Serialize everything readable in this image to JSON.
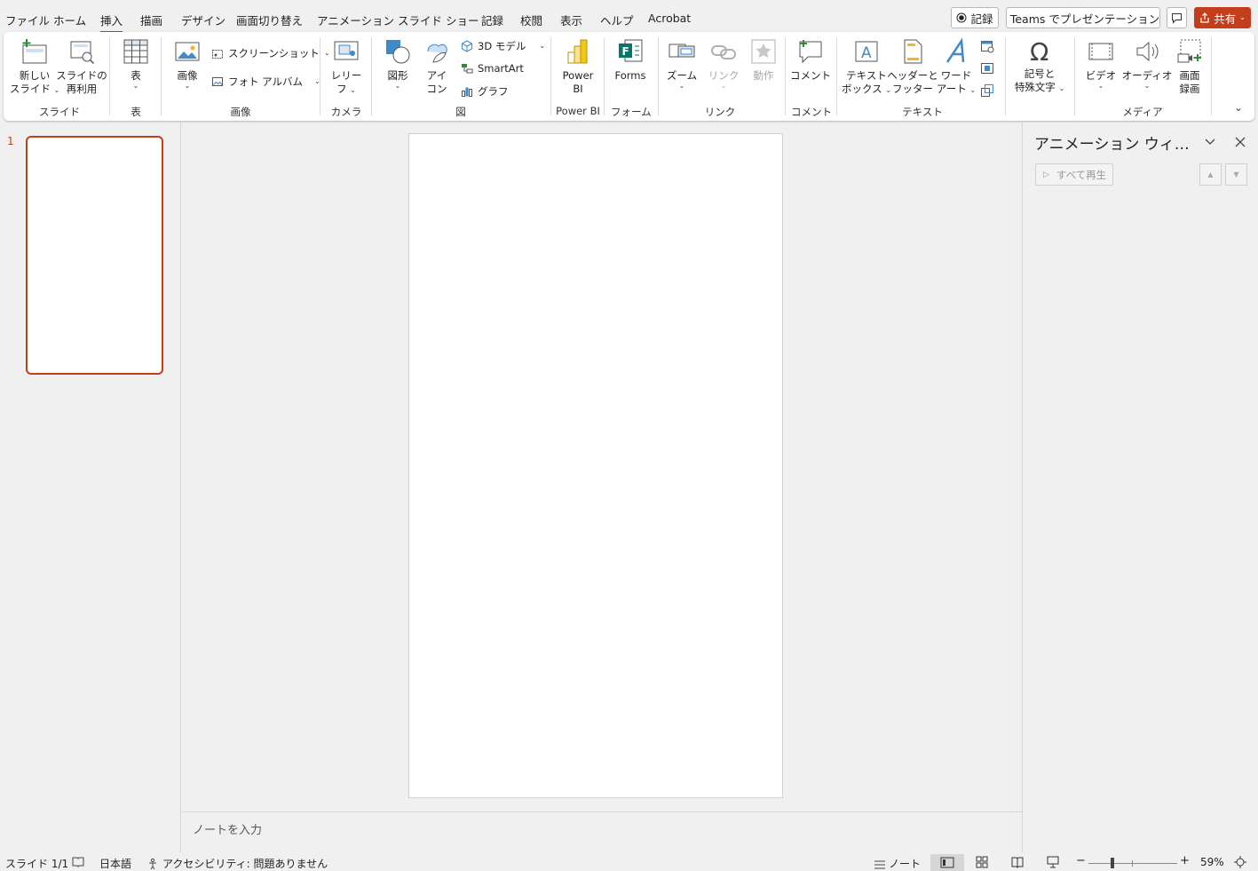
{
  "menubar": {
    "tabs": [
      "ファイル",
      "ホーム",
      "挿入",
      "描画",
      "デザイン",
      "画面切り替え",
      "アニメーション",
      "スライド ショー",
      "記録",
      "校閲",
      "表示",
      "ヘルプ",
      "Acrobat"
    ],
    "active_tab": "挿入",
    "record_label": "記録",
    "teams_label": "Teams でプレゼンテーション",
    "share_label": "共有"
  },
  "ribbon": {
    "groups": {
      "slides": "スライド",
      "tables": "表",
      "images": "画像",
      "camera": "カメラ",
      "illustrations": "図",
      "powerbi": "Power BI",
      "forms": "フォーム",
      "links": "リンク",
      "comments": "コメント",
      "text": "テキスト",
      "media": "メディア"
    },
    "new_slide": [
      "新しい",
      "スライド"
    ],
    "reuse_slides": [
      "スライドの",
      "再利用"
    ],
    "table": "表",
    "pictures": "画像",
    "screenshot": "スクリーンショット",
    "photo_album": "フォト アルバム",
    "cameo": [
      "レリー",
      "フ"
    ],
    "shapes": "図形",
    "icons": [
      "アイ",
      "コン"
    ],
    "model3d": "3D モデル",
    "smartart": "SmartArt",
    "chart": "グラフ",
    "powerbi": [
      "Power",
      "BI"
    ],
    "forms": "Forms",
    "zoom": "ズーム",
    "link": "リンク",
    "action": "動作",
    "comment": "コメント",
    "textbox": [
      "テキスト",
      "ボックス"
    ],
    "header_footer": [
      "ヘッダーと",
      "フッター"
    ],
    "wordart": [
      "ワード",
      "アート"
    ],
    "symbols": [
      "記号と",
      "特殊文字"
    ],
    "video": "ビデオ",
    "audio": "オーディオ",
    "screen_recording": [
      "画面",
      "録画"
    ]
  },
  "thumbnails": {
    "slide_number": "1"
  },
  "notes_placeholder": "ノートを入力",
  "animation_pane": {
    "title": "アニメーション ウィ…",
    "play_all": "すべて再生"
  },
  "statusbar": {
    "slide_info": "スライド 1/1",
    "language": "日本語",
    "accessibility": "アクセシビリティ: 問題ありません",
    "notes": "ノート",
    "zoom_level": "59%"
  },
  "colors": {
    "accent": "#c43e1c"
  }
}
